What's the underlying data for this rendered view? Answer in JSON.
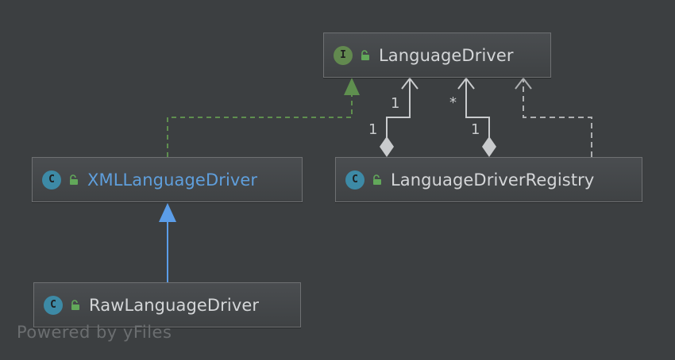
{
  "nodes": {
    "language_driver": {
      "name": "LanguageDriver",
      "kind": "I"
    },
    "xml_language_driver": {
      "name": "XMLLanguageDriver",
      "kind": "C"
    },
    "language_driver_registry": {
      "name": "LanguageDriverRegistry",
      "kind": "C"
    },
    "raw_language_driver": {
      "name": "RawLanguageDriver",
      "kind": "C"
    }
  },
  "multiplicities": {
    "assoc1_target": "1",
    "assoc1_source": "1",
    "assoc2_target": "*",
    "assoc2_source": "1"
  },
  "watermark": "Powered by yFiles",
  "colors": {
    "background": "#3c3f41",
    "interface_badge": "#62894f",
    "class_badge": "#3d8aa6",
    "implementation_edge": "#5f8f4f",
    "inheritance_edge": "#5b9de8",
    "association_edge": "#c9cbcd",
    "dependency_edge": "#aeb0b2",
    "highlight_text": "#5f9fdc"
  },
  "icons": {
    "interface_badge": "interface-icon",
    "class_badge": "class-icon",
    "visibility": "public-lock-icon"
  }
}
